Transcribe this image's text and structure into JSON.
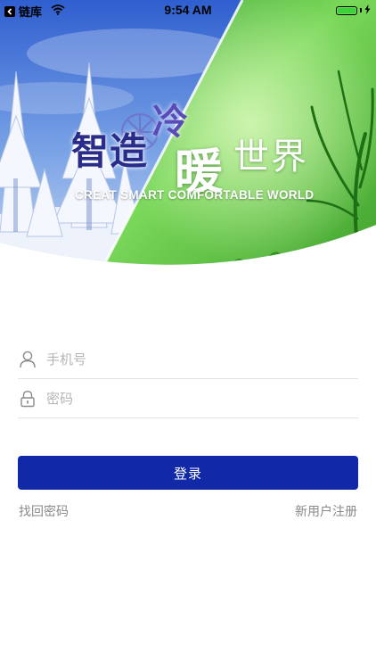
{
  "status_bar": {
    "back_app": "链库",
    "time": "9:54 AM",
    "icons": [
      "back-arrow-icon",
      "wifi-icon",
      "battery-icon",
      "charging-bolt-icon"
    ]
  },
  "banner": {
    "title_part1": "智造",
    "title_cold": "冷",
    "title_warm": "暖",
    "title_part2": "世界",
    "slogan": "CREAT SMART COMFORTABLE WORLD",
    "colors": {
      "sky": "#3d6fd6",
      "snow": "#f2f5fb",
      "green": "#4fc43a"
    }
  },
  "form": {
    "phone_placeholder": "手机号",
    "phone_value": "",
    "password_placeholder": "密码",
    "password_value": "",
    "icons": [
      "user-icon",
      "lock-icon"
    ]
  },
  "actions": {
    "login_label": "登录",
    "forgot_label": "找回密码",
    "register_label": "新用户注册",
    "accent": "#1129a6"
  }
}
